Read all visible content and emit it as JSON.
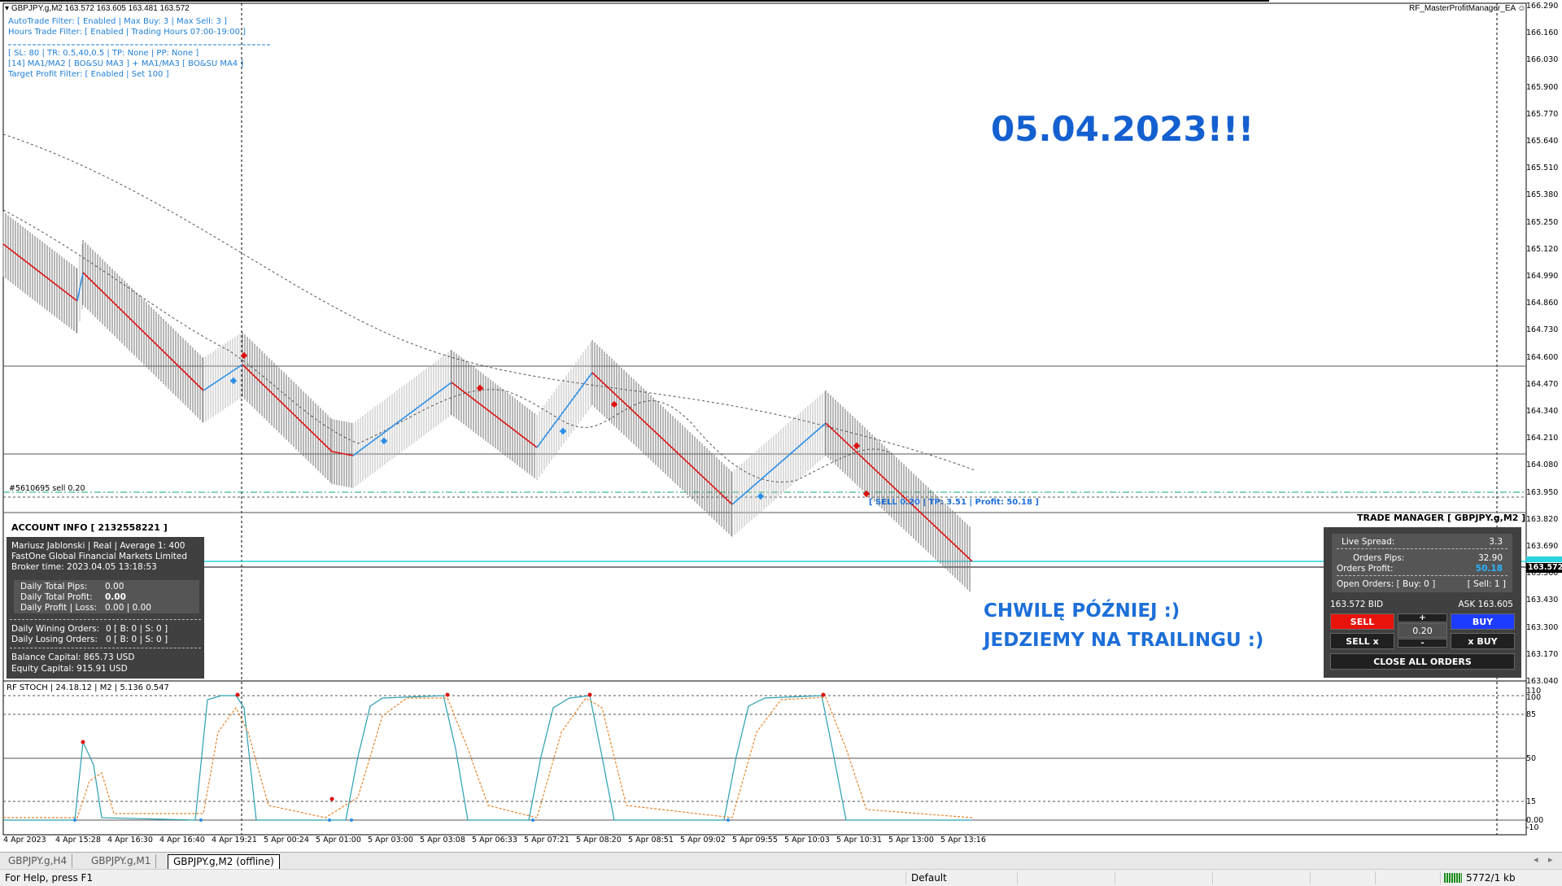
{
  "chart_header": {
    "symbol_line": "GBPJPY.g,M2  163.572 163.605 163.481 163.572",
    "expert_name": "RF_MasterProfitManager_EA"
  },
  "info_lines": [
    "AutoTrade Filter: [ Enabled | Max Buy: 3 | Max Sell: 3 ]",
    "Hours Trade Filter: [ Enabled | Trading Hours 07:00-19:00 ]",
    "----------------------------------------------",
    "[ SL: 80 | TR: 0.5,40,0.5 | TP: None | PP: None ]",
    "[14] MA1/MA2 [ BO&SU MA3 ] + MA1/MA3 [ BO&SU MA4 ]",
    "Target Profit Filter: [ Enabled | Set 100 ]"
  ],
  "annotation": {
    "date": "05.04.2023!!!",
    "line1": "CHWILĘ PÓŹNIEJ :)",
    "line2": "JEDZIEMY NA TRAILINGU :)"
  },
  "order": {
    "label": "#5610695 sell 0.20",
    "status": "[ SELL 0.20 | TP: 3.51 | Profit: 50.18 ]"
  },
  "account_info": {
    "title": "ACCOUNT INFO [ 2132558221 ]",
    "name_line": "Mariusz Jablonski | Real | Average 1: 400",
    "broker": "FastOne Global Financial Markets Limited",
    "broker_time": "Broker time: 2023.04.05 13:18:53",
    "daily_pips_label": "Daily Total Pips:",
    "daily_pips": "0.00",
    "daily_profit_label": "Daily Total Profit:",
    "daily_profit": "0.00",
    "daily_pl_label": "Daily Profit | Loss:",
    "daily_pl": "0.00 | 0.00",
    "winning_label": "Daily Wining Orders:",
    "winning": "0    [ B: 0 | S: 0 ]",
    "losing_label": "Daily Losing Orders:",
    "losing": "0    [ B: 0 | S: 0 ]",
    "balance": "Balance Capital:  865.73 USD",
    "equity": "Equity Capital:   915.91 USD"
  },
  "trade_manager": {
    "title": "TRADE MANAGER [ GBPJPY.g,M2 ]",
    "spread_label": "Live Spread:",
    "spread": "3.3",
    "pips_label": "Orders Pips:",
    "pips": "32.90",
    "profit_label": "Orders Profit:",
    "profit": "50.18",
    "open_orders": "Open Orders:  [ Buy: 0 ]",
    "open_sell": "[ Sell: 1 ]",
    "bid": "163.572 BID",
    "ask": "ASK 163.605",
    "sell_btn": "SELL",
    "buy_btn": "BUY",
    "plus_btn": "+",
    "minus_btn": "-",
    "lot": "0.20",
    "sellx_btn": "SELL x",
    "xbuy_btn": "x BUY",
    "close_btn": "CLOSE ALL ORDERS"
  },
  "price_axis": [
    "166.290",
    "166.160",
    "166.030",
    "165.900",
    "165.770",
    "165.640",
    "165.510",
    "165.380",
    "165.250",
    "165.120",
    "164.990",
    "164.860",
    "164.730",
    "164.600",
    "164.470",
    "164.340",
    "164.210",
    "164.080",
    "163.950",
    "163.820",
    "163.690",
    "163.560",
    "163.430",
    "163.300",
    "163.170",
    "163.040"
  ],
  "current_price": "163.572",
  "stoch": {
    "label": "RF STOCH | 24.18.12 | M2 | 5.136 0.547",
    "axis": [
      "110",
      "100",
      "85",
      "50",
      "15",
      "0.00",
      "-10"
    ]
  },
  "time_axis": [
    "4 Apr 2023",
    "4 Apr 15:28",
    "4 Apr 16:30",
    "4 Apr 16:40",
    "4 Apr 19:21",
    "5 Apr 00:24",
    "5 Apr 01:00",
    "5 Apr 03:00",
    "5 Apr 03:08",
    "5 Apr 06:33",
    "5 Apr 07:21",
    "5 Apr 08:20",
    "5 Apr 08:51",
    "5 Apr 09:02",
    "5 Apr 09:55",
    "5 Apr 10:03",
    "5 Apr 10:31",
    "5 Apr 13:00",
    "5 Apr 13:16"
  ],
  "tabs": [
    "GBPJPY.g,H4",
    "GBPJPY.g,M1",
    "GBPJPY.g,M2 (offline)"
  ],
  "status": {
    "help": "For Help, press F1",
    "profile": "Default",
    "traffic": "5772/1 kb"
  },
  "colors": {
    "sell_red": "#e8140c",
    "buy_blue": "#1e3cff",
    "ma_blue": "#2b8fe8",
    "ma_red": "#e01010",
    "panel": "#404040"
  }
}
